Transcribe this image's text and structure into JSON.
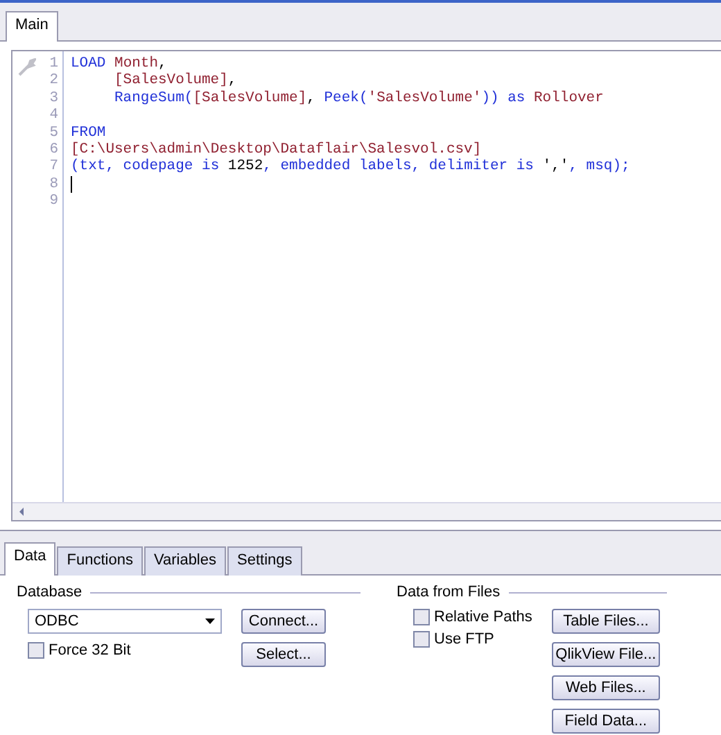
{
  "editor_tabs": [
    {
      "label": "Main",
      "selected": true
    }
  ],
  "code_lines": [
    {
      "number": "1",
      "tokens": [
        {
          "text": "LOAD ",
          "kind": "keyword"
        },
        {
          "text": "Month",
          "kind": "field"
        },
        {
          "text": ",",
          "kind": "plain"
        }
      ]
    },
    {
      "number": "2",
      "indented": true,
      "tokens": [
        {
          "text": "[SalesVolume]",
          "kind": "field"
        },
        {
          "text": ",",
          "kind": "plain"
        }
      ]
    },
    {
      "number": "3",
      "indented": true,
      "tokens": [
        {
          "text": "RangeSum(",
          "kind": "keyword"
        },
        {
          "text": "[SalesVolume]",
          "kind": "field"
        },
        {
          "text": ", ",
          "kind": "plain"
        },
        {
          "text": "Peek(",
          "kind": "keyword"
        },
        {
          "text": "'SalesVolume'",
          "kind": "field"
        },
        {
          "text": ")) as ",
          "kind": "keyword"
        },
        {
          "text": "Rollover",
          "kind": "field"
        }
      ]
    },
    {
      "number": "4"
    },
    {
      "number": "5",
      "tokens": [
        {
          "text": "FROM",
          "kind": "keyword"
        }
      ]
    },
    {
      "number": "6",
      "tokens": [
        {
          "text": "[C:\\Users\\admin\\Desktop\\Dataflair\\Salesvol.csv]",
          "kind": "field"
        }
      ]
    },
    {
      "number": "7",
      "tokens": [
        {
          "text": "(txt, codepage is ",
          "kind": "keyword"
        },
        {
          "text": "1252",
          "kind": "plain"
        },
        {
          "text": ", embedded labels, delimiter is ",
          "kind": "keyword"
        },
        {
          "text": "','",
          "kind": "plain"
        },
        {
          "text": ", msq);",
          "kind": "keyword"
        }
      ]
    },
    {
      "number": "8",
      "cursor": true
    },
    {
      "number": "9"
    }
  ],
  "panel_tabs": [
    {
      "label": "Data",
      "selected": true
    },
    {
      "label": "Functions",
      "selected": false
    },
    {
      "label": "Variables",
      "selected": false
    },
    {
      "label": "Settings",
      "selected": false
    }
  ],
  "database": {
    "title": "Database",
    "dropdown_value": "ODBC",
    "force_32_bit": {
      "label": "Force 32 Bit",
      "checked": false
    },
    "buttons": [
      "Connect...",
      "Select..."
    ]
  },
  "data_from_files": {
    "title": "Data from Files",
    "options": [
      {
        "label": "Relative Paths",
        "checked": false
      },
      {
        "label": "Use FTP",
        "checked": false
      }
    ],
    "buttons": [
      "Table Files...",
      "QlikView File...",
      "Web Files...",
      "Field Data..."
    ]
  }
}
